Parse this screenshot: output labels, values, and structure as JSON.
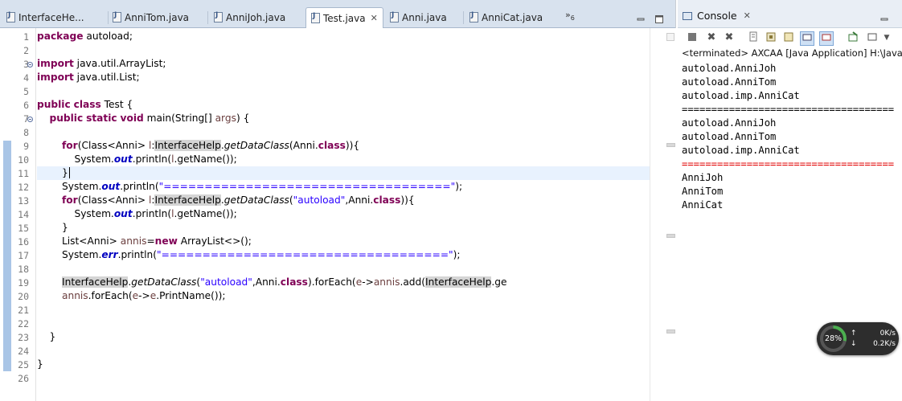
{
  "editor": {
    "tabs": [
      {
        "label": "InterfaceHe..."
      },
      {
        "label": "AnniTom.java"
      },
      {
        "label": "AnniJoh.java"
      },
      {
        "label": "Test.java",
        "active": true
      },
      {
        "label": "Anni.java"
      },
      {
        "label": "AnniCat.java"
      }
    ],
    "overflow_label": "»",
    "overflow_count": "6",
    "line_numbers": [
      "1",
      "2",
      "3",
      "4",
      "5",
      "6",
      "7",
      "8",
      "9",
      "10",
      "11",
      "12",
      "13",
      "14",
      "15",
      "16",
      "17",
      "18",
      "19",
      "20",
      "21",
      "22",
      "23",
      "24",
      "25",
      "26"
    ],
    "current_line": 11
  },
  "console": {
    "title": "Console",
    "status": "<terminated> AXCAA [Java Application] H:\\Java",
    "output": [
      {
        "text": "autoload.AnniJoh",
        "stream": "out"
      },
      {
        "text": "autoload.AnniTom",
        "stream": "out"
      },
      {
        "text": "autoload.imp.AnniCat",
        "stream": "out"
      },
      {
        "text": "====================================",
        "stream": "out"
      },
      {
        "text": "autoload.AnniJoh",
        "stream": "out"
      },
      {
        "text": "autoload.AnniTom",
        "stream": "out"
      },
      {
        "text": "autoload.imp.AnniCat",
        "stream": "out"
      },
      {
        "text": "====================================",
        "stream": "err"
      },
      {
        "text": "AnniJoh",
        "stream": "out"
      },
      {
        "text": "AnniTom",
        "stream": "out"
      },
      {
        "text": "AnniCat",
        "stream": "out"
      }
    ]
  },
  "network_widget": {
    "percent": "28%",
    "upload": "0K/s",
    "download": "0.2K/s"
  },
  "colors": {
    "keyword": "#7f0055",
    "string": "#2a00ff",
    "field": "#0000c0",
    "error": "#e00000",
    "change_bar": "#a9c5e6"
  }
}
